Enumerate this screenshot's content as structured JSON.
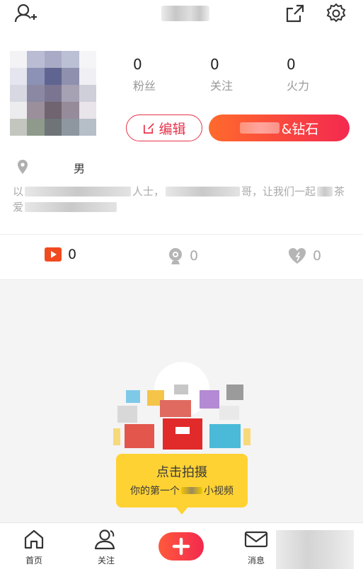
{
  "header": {
    "add_friend_icon": "person-plus-icon",
    "share_icon": "share-icon",
    "settings_icon": "gear-icon"
  },
  "profile": {
    "stats": [
      {
        "value": "0",
        "label": "粉丝"
      },
      {
        "value": "0",
        "label": "关注"
      },
      {
        "value": "0",
        "label": "火力"
      }
    ],
    "edit_button": "编辑",
    "vip_button_suffix": "&钻石",
    "gender": "男",
    "bio_fragments": [
      "以",
      "人士，",
      "哥，让我们一起",
      "茶",
      "爱"
    ]
  },
  "counts": {
    "videos": "0",
    "live": "0",
    "likes": "0"
  },
  "prompt": {
    "title": "点击拍摄",
    "subtitle_start": "你的第一个",
    "subtitle_end": "小视频"
  },
  "bottom_nav": {
    "items": [
      {
        "label": "首页",
        "icon": "home-icon"
      },
      {
        "label": "关注",
        "icon": "people-icon"
      },
      {
        "label": "",
        "icon": "plus-icon"
      },
      {
        "label": "消息",
        "icon": "mail-icon"
      }
    ]
  },
  "colors": {
    "accent": "#f4294f",
    "accent_orange": "#ff6a2c",
    "tip_yellow": "#ffd233"
  }
}
